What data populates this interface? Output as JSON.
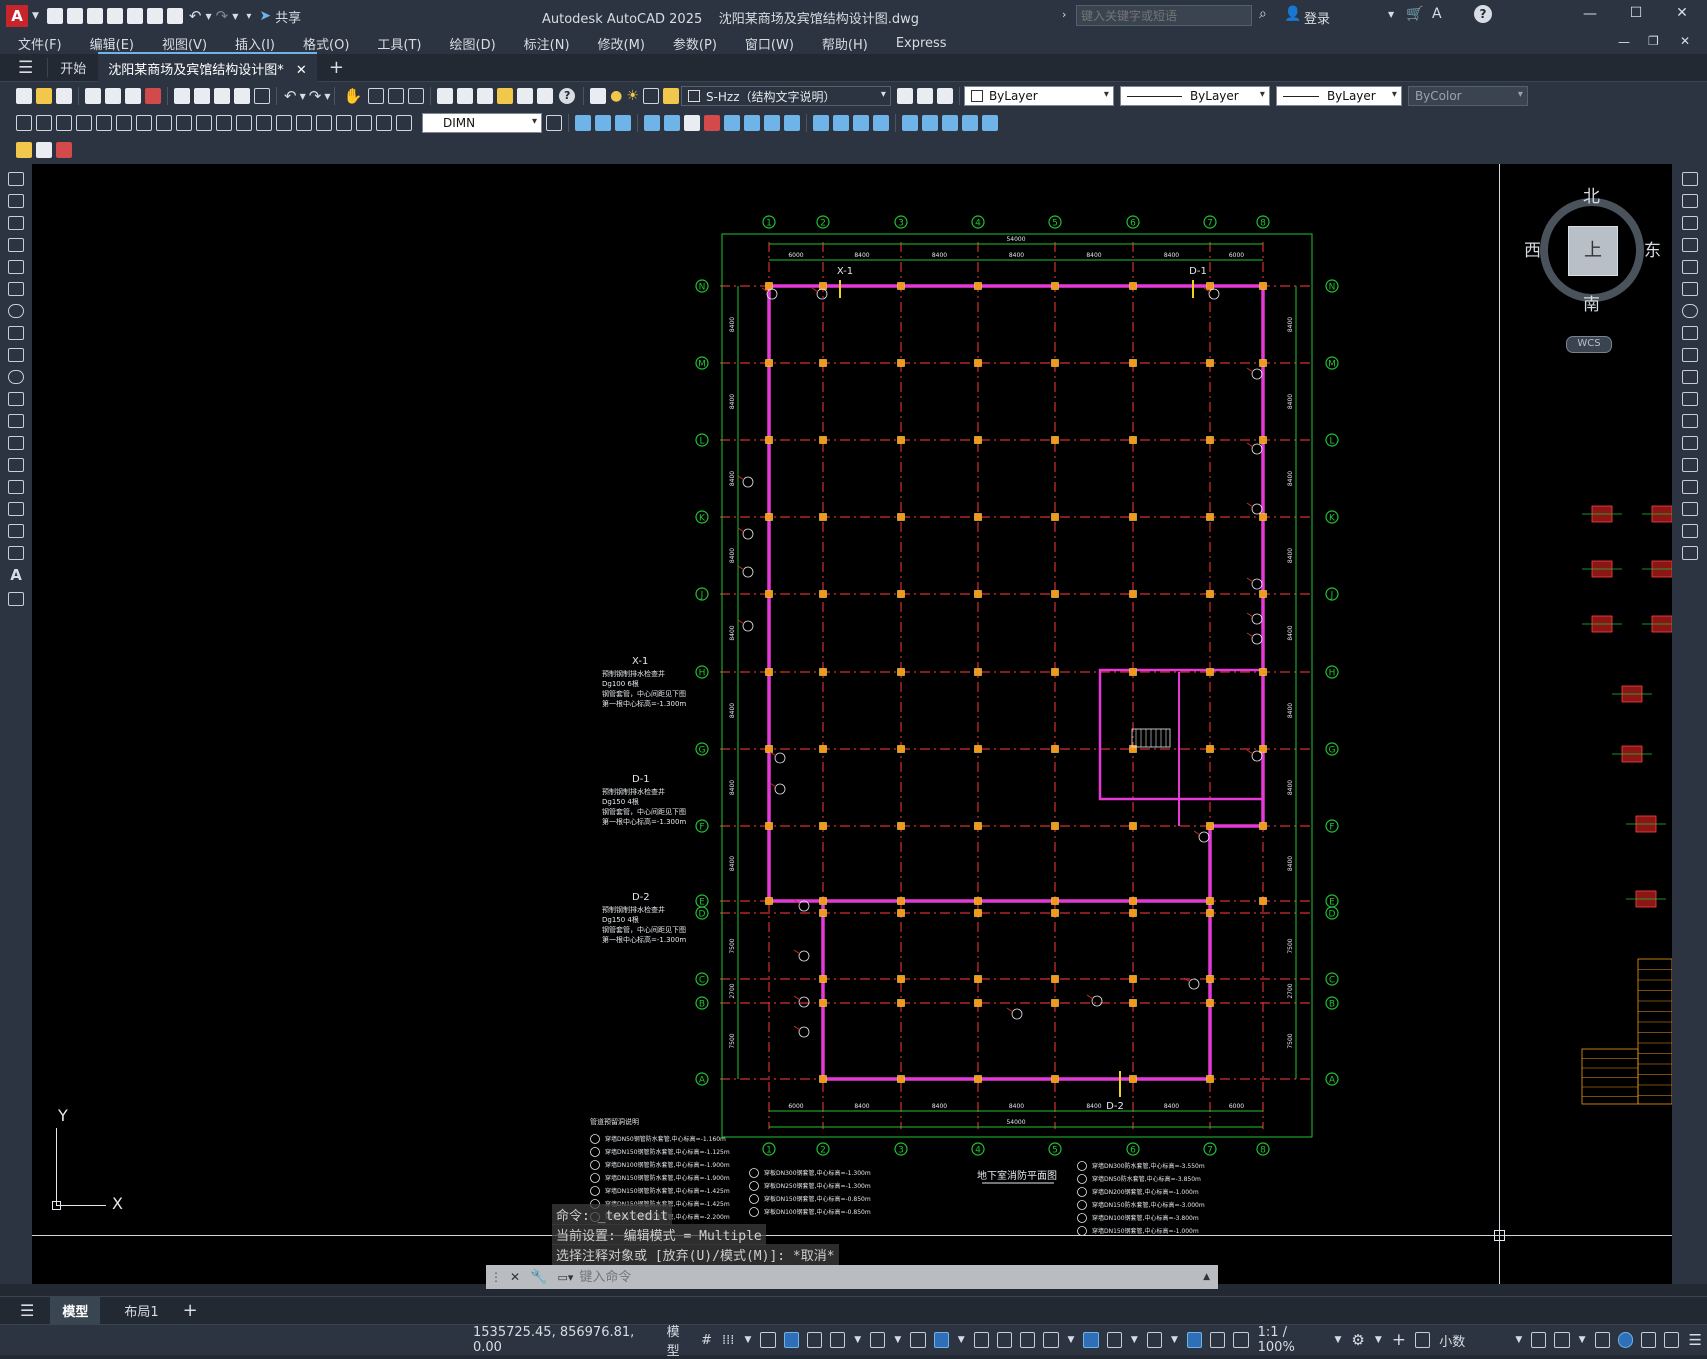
{
  "titlebar": {
    "app_letter": "A",
    "share_label": "共享",
    "title": "Autodesk AutoCAD 2025    沈阳某商场及宾馆结构设计图.dwg",
    "search_placeholder": "键入关键字或短语",
    "login_label": "登录"
  },
  "menubar": {
    "items": [
      "文件(F)",
      "编辑(E)",
      "视图(V)",
      "插入(I)",
      "格式(O)",
      "工具(T)",
      "绘图(D)",
      "标注(N)",
      "修改(M)",
      "参数(P)",
      "窗口(W)",
      "帮助(H)",
      "Express"
    ]
  },
  "doc_tabs": {
    "start_label": "开始",
    "active_label": "沈阳某商场及宾馆结构设计图*"
  },
  "properties": {
    "layer": "S-Hzz（结构文字说明）",
    "color": "ByLayer",
    "linetype": "ByLayer",
    "lineweight": "ByLayer",
    "plotstyle": "ByColor",
    "dimstyle": "DIMN"
  },
  "viewcube": {
    "north": "北",
    "south": "南",
    "east": "东",
    "west": "西",
    "top_face": "上",
    "wcs": "WCS"
  },
  "ucs": {
    "x": "X",
    "y": "Y"
  },
  "drawing": {
    "grid_cols": [
      "1",
      "2",
      "3",
      "4",
      "5",
      "6",
      "7",
      "8"
    ],
    "grid_rows": [
      "N",
      "M",
      "L",
      "K",
      "J",
      "H",
      "G",
      "F",
      "E",
      "D",
      "C",
      "B",
      "A"
    ],
    "col_spacings": [
      "6000",
      "8400",
      "8400",
      "8400",
      "8400",
      "8400",
      "6000"
    ],
    "total_width": "54000",
    "row_spacings": [
      "8400",
      "8400",
      "8400",
      "8400",
      "8400",
      "8400",
      "8400",
      "8400",
      "8400",
      "7500",
      "2700",
      "7500"
    ],
    "plan_title": "地下室消防平面图",
    "label_x1": "X-1",
    "label_d1": "D-1",
    "label_d2": "D-2",
    "notes_left": [
      {
        "title": "X-1",
        "lines": [
          "预制钢制排水检查井",
          "Dg100 6根",
          "钢管套管，中心间距见下图",
          "第一根中心标高=-1.300m"
        ]
      },
      {
        "title": "D-1",
        "lines": [
          "预制钢制排水检查井",
          "Dg150 4根",
          "钢管套管，中心间距见下图",
          "第一根中心标高=-1.300m"
        ]
      },
      {
        "title": "D-2",
        "lines": [
          "预制钢制排水检查井",
          "Dg150 4根",
          "钢管套管，中心间距见下图",
          "第一根中心标高=-1.300m"
        ]
      }
    ],
    "legend_title": "管道预留洞说明",
    "legend_a": [
      "穿墙DN50钢管防水套管,中心标高=-1.160m",
      "穿墙DN150钢管防水套管,中心标高=-1.125m",
      "穿墙DN100钢管防水套管,中心标高=-1.900m",
      "穿墙DN150钢管防水套管,中心标高=-1.900m",
      "穿墙DN150钢管防水套管,中心标高=-1.425m",
      "穿墙DN150钢管防水套管,中心标高=-1.425m",
      "穿墙DN150钢管防水套管,中心标高=-2.200m"
    ],
    "legend_b": [
      "穿板DN300钢套管,中心标高=-1.300m",
      "穿板DN250钢套管,中心标高=-1.300m",
      "穿板DN150钢套管,中心标高=-0.850m",
      "穿板DN100钢套管,中心标高=-0.850m"
    ],
    "legend_c": [
      "穿墙DN300防水套管,中心标高=-3.550m",
      "穿墙DN50防水套管,中心标高=-3.850m",
      "穿墙DN200钢套管,中心标高=-1.000m",
      "穿墙DN150防水套管,中心标高=-3.000m",
      "穿墙DN100钢套管,中心标高=-3.800m",
      "穿墙DN150钢套管,中心标高=-1.000m"
    ]
  },
  "command": {
    "history": [
      "命令: _textedit",
      "当前设置: 编辑模式 = Multiple",
      "选择注释对象或 [放弃(U)/模式(M)]: *取消*"
    ],
    "placeholder": "键入命令"
  },
  "layout_tabs": {
    "model": "模型",
    "layout1": "布局1"
  },
  "status": {
    "coords": "1535725.45, 856976.81, 0.00",
    "model": "模型",
    "scale": "1:1 / 100%",
    "units": "小数"
  }
}
